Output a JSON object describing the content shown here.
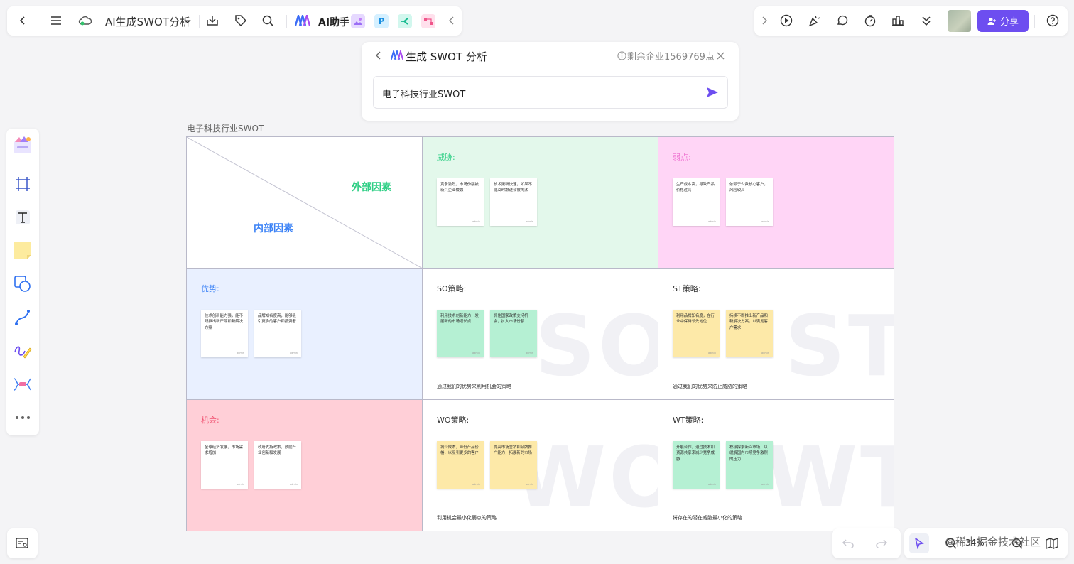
{
  "toolbar": {
    "doc_title": "AI生成SWOT分析",
    "ai_label": "AI助手",
    "app_chip_p": "P"
  },
  "top_right": {
    "share_label": "分享"
  },
  "ai_dialog": {
    "title": "生成 SWOT 分析",
    "credit": "剩余企业1569769点",
    "input_value": "电子科技行业SWOT"
  },
  "board": {
    "title": "电子科技行业SWOT",
    "external_label": "外部因素",
    "internal_label": "内部因素",
    "cells": {
      "threat": {
        "label": "威胁:",
        "notes": [
          "竞争激烈，市场份额被新兴企业侵蚀",
          "技术更新快速，如果不能及时跟进会被淘汰"
        ]
      },
      "weakness": {
        "label": "弱点:",
        "notes": [
          "生产成本高，导致产品价格过高",
          "依赖于少数核心客户，风险较高"
        ]
      },
      "strength": {
        "label": "优势:",
        "notes": [
          "技术创新能力强，能不断推出新产品和新解决方案",
          "品牌知名度高，能够吸引更多的客户和投资者"
        ]
      },
      "so": {
        "label": "SO策略:",
        "watermark": "SO",
        "desc": "通过我们的优势来利用机会的策略",
        "notes": [
          "利用技术创新能力，发展新的市场增长点",
          "抓住国家政策支持机会，扩大市场份额"
        ]
      },
      "st": {
        "label": "ST策略:",
        "watermark": "ST",
        "desc": "通过我们的优势来防止威胁的策略",
        "notes": [
          "利用品牌知名度，在行业中保持领先地位",
          "持续不断推出新产品和新解决方案，以满足客户需求"
        ]
      },
      "opportunity": {
        "label": "机会:",
        "notes": [
          "全球经济发展，市场需求增加",
          "政府支持政策，鼓励产业创新和发展"
        ]
      },
      "wo": {
        "label": "WO策略:",
        "watermark": "WO",
        "desc": "利用机会最小化弱点的策略",
        "notes": [
          "减少成本，降低产品价格，以吸引更多的客户",
          "提高市场营销和品牌推广能力，拓展新的市场"
        ]
      },
      "wt": {
        "label": "WT策略:",
        "watermark": "WT",
        "desc": "将存在的潜在威胁最小化的策略",
        "notes": [
          "开展合作，通过技术和资源共享来减少竞争威胁",
          "积极探索新兴市场，以缓解国内市场竞争激烈的压力"
        ]
      }
    }
  },
  "zoom": {
    "value": "34%"
  },
  "watermark_text": "@稀土掘金技术社区",
  "colors": {
    "accent": "#6d4ef0",
    "threat_bg": "#e3f8eb",
    "weakness_bg": "#ffd5f6",
    "strength_bg": "#e9f0ff",
    "opportunity_bg": "#ffcfd7",
    "green_text": "#2fcf85",
    "pink_text": "#f07ad4",
    "blue_text": "#3b82f6",
    "red_text": "#f15573",
    "sticky_white": "#ffffff",
    "sticky_green": "#b5f0d3",
    "sticky_yellow": "#fde9a8"
  }
}
